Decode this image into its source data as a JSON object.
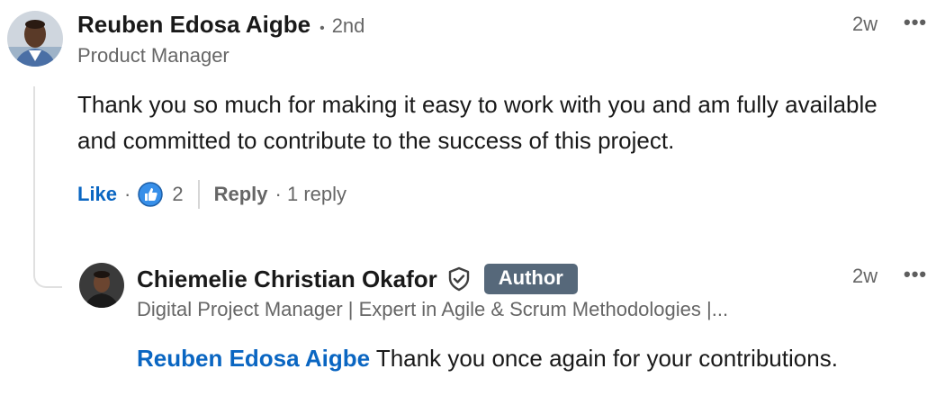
{
  "comment": {
    "author_name": "Reuben Edosa Aigbe",
    "degree_separator": "•",
    "degree": "2nd",
    "headline": "Product Manager",
    "time": "2w",
    "more_label": "•••",
    "text": "Thank you so much for making it easy to work with you and am fully available and committed to contribute to the success of this project.",
    "like_label": "Like",
    "dot": "·",
    "reaction_count": "2",
    "reaction_icon": "thumbs-up-icon",
    "reply_label": "Reply",
    "replies_count_label": "· 1 reply"
  },
  "reply": {
    "author_name": "Chiemelie Christian Okafor",
    "verified_icon": "shield-check-icon",
    "badge": "Author",
    "headline": "Digital Project Manager | Expert in Agile & Scrum Methodologies |...",
    "time": "2w",
    "more_label": "•••",
    "mention": "Reuben Edosa Aigbe",
    "text": " Thank you once again for your contributions."
  },
  "colors": {
    "link_blue": "#0a66c2",
    "badge_bg": "#56687a",
    "muted_text": "#666666"
  }
}
